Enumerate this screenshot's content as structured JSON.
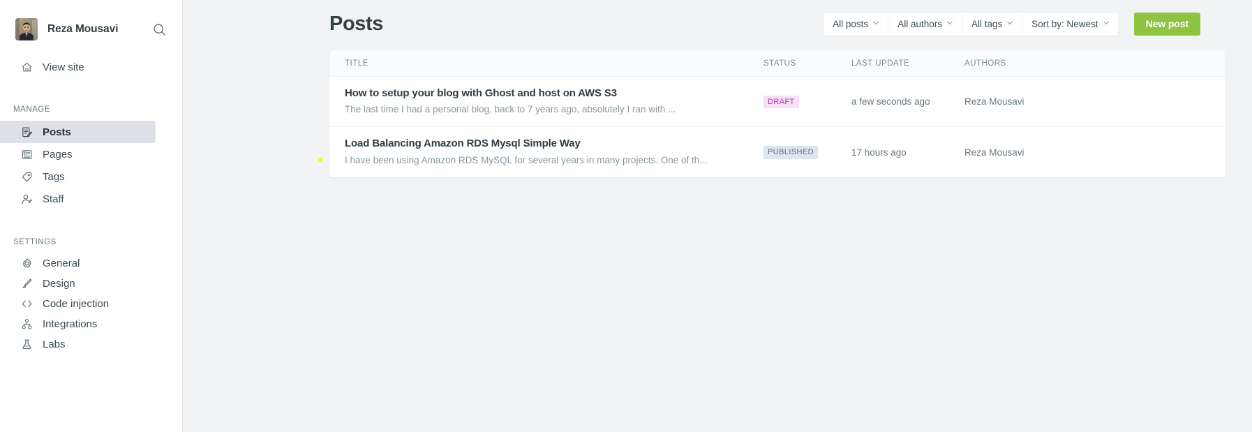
{
  "sidebar": {
    "user": {
      "name": "Reza Mousavi",
      "avatar_icon": "user-photo-avatar"
    },
    "search_icon": "search-icon",
    "view_site": {
      "label": "View site",
      "icon": "home-icon"
    },
    "groups": [
      {
        "label": "Manage",
        "items": [
          {
            "label": "Posts",
            "icon": "posts-icon",
            "active": true
          },
          {
            "label": "Pages",
            "icon": "pages-icon",
            "active": false
          },
          {
            "label": "Tags",
            "icon": "tag-icon",
            "active": false
          },
          {
            "label": "Staff",
            "icon": "staff-icon",
            "active": false
          }
        ]
      },
      {
        "label": "Settings",
        "items": [
          {
            "label": "General",
            "icon": "gear-icon",
            "active": false
          },
          {
            "label": "Design",
            "icon": "paintbrush-icon",
            "active": false
          },
          {
            "label": "Code injection",
            "icon": "code-brackets-icon",
            "active": false
          },
          {
            "label": "Integrations",
            "icon": "integrations-icon",
            "active": false
          },
          {
            "label": "Labs",
            "icon": "flask-icon",
            "active": false
          }
        ]
      }
    ]
  },
  "header": {
    "title": "Posts",
    "filters": [
      {
        "label": "All posts",
        "icon": "chevron-down-icon"
      },
      {
        "label": "All authors",
        "icon": "chevron-down-icon"
      },
      {
        "label": "All tags",
        "icon": "chevron-down-icon"
      },
      {
        "label": "Sort by: Newest",
        "icon": "chevron-down-icon"
      }
    ],
    "new_post_label": "New post",
    "new_post_color": "#8fc342"
  },
  "table": {
    "columns": {
      "title": "TITLE",
      "status": "STATUS",
      "last_update": "LAST UPDATE",
      "authors": "AUTHORS"
    },
    "rows": [
      {
        "title": "How to setup your blog with Ghost and host on AWS S3",
        "excerpt": "The last time I had a personal blog, back to 7 years ago, absolutely I ran with ...",
        "status": "DRAFT",
        "status_color": "#a63bb0",
        "status_bg": "#f7e0f6",
        "last_update": "a few seconds ago",
        "author": "Reza Mousavi"
      },
      {
        "title": "Load Balancing Amazon RDS Mysql Simple Way",
        "excerpt": "I have been using Amazon RDS MySQL for several years in many projects. One of th...",
        "status": "PUBLISHED",
        "status_color": "#5f7082",
        "status_bg": "#dde5ee",
        "last_update": "17 hours ago",
        "author": "Reza Mousavi"
      }
    ]
  },
  "marker": {
    "name": "cursor-marker-dot",
    "color": "#fbff00"
  }
}
